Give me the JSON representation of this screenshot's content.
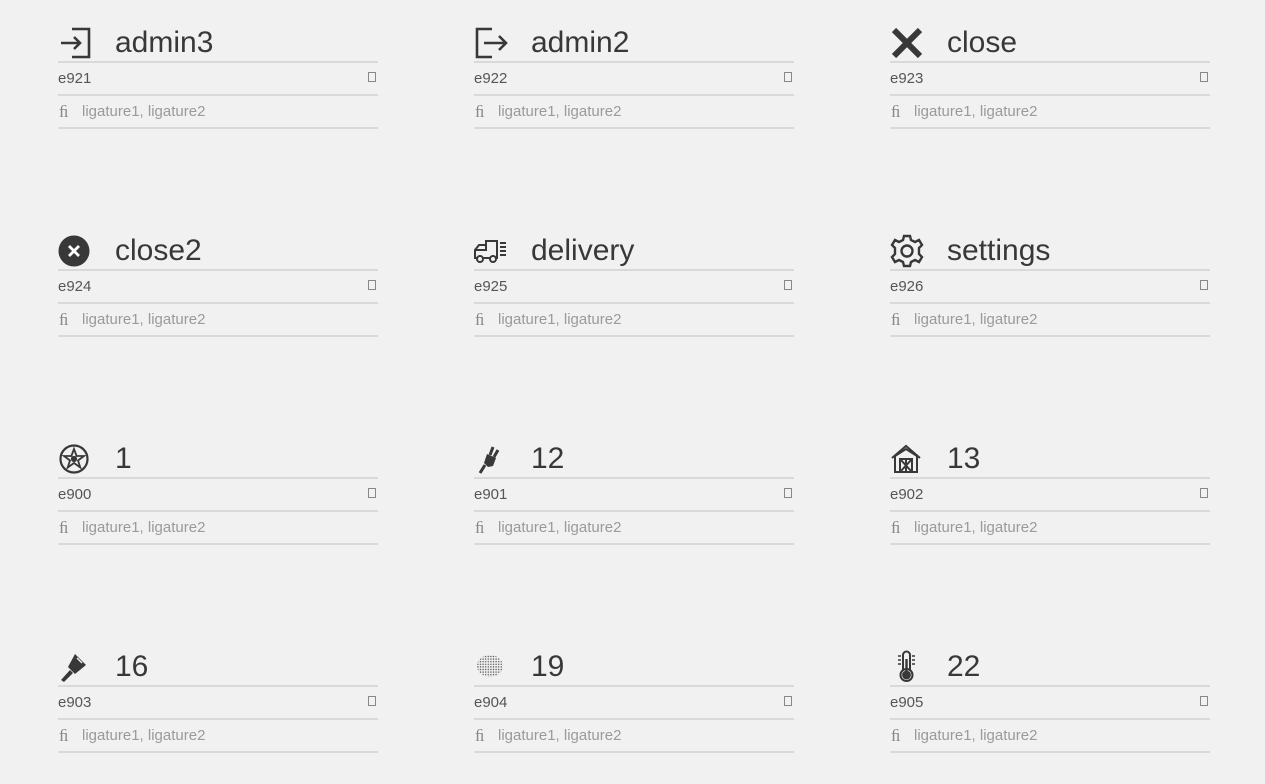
{
  "glyph_set": [
    {
      "name": "admin3",
      "code": "e921",
      "ligatures": "ligature1, ligature2",
      "icon": "admin3-enter-icon"
    },
    {
      "name": "admin2",
      "code": "e922",
      "ligatures": "ligature1, ligature2",
      "icon": "admin2-exit-icon"
    },
    {
      "name": "close",
      "code": "e923",
      "ligatures": "ligature1, ligature2",
      "icon": "close-x-icon"
    },
    {
      "name": "close2",
      "code": "e924",
      "ligatures": "ligature1, ligature2",
      "icon": "close-circle-icon"
    },
    {
      "name": "delivery",
      "code": "e925",
      "ligatures": "ligature1, ligature2",
      "icon": "delivery-truck-icon"
    },
    {
      "name": "settings",
      "code": "e926",
      "ligatures": "ligature1, ligature2",
      "icon": "settings-gear-icon"
    },
    {
      "name": "1",
      "code": "e900",
      "ligatures": "ligature1, ligature2",
      "icon": "wheel-star-icon"
    },
    {
      "name": "12",
      "code": "e901",
      "ligatures": "ligature1, ligature2",
      "icon": "plug-icon"
    },
    {
      "name": "13",
      "code": "e902",
      "ligatures": "ligature1, ligature2",
      "icon": "house-frame-icon"
    },
    {
      "name": "16",
      "code": "e903",
      "ligatures": "ligature1, ligature2",
      "icon": "brush-icon"
    },
    {
      "name": "19",
      "code": "e904",
      "ligatures": "ligature1, ligature2",
      "icon": "dotted-sphere-icon"
    },
    {
      "name": "22",
      "code": "e905",
      "ligatures": "ligature1, ligature2",
      "icon": "thermometer-icon"
    }
  ],
  "colors": {
    "background": "#f1f1f1",
    "text": "#383838",
    "divider": "#d9d9d9",
    "muted": "#9a9a9a"
  }
}
